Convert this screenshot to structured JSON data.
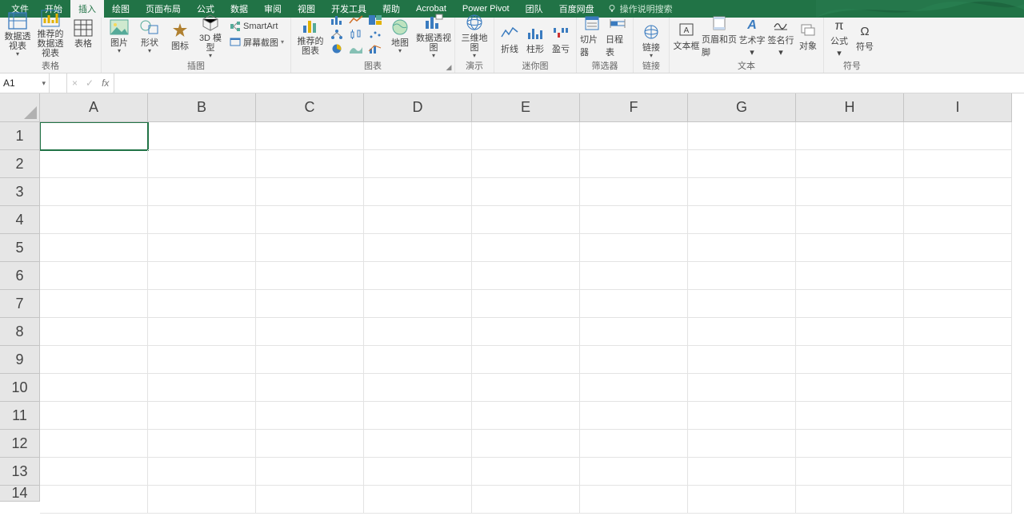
{
  "tabs": {
    "items": [
      "文件",
      "开始",
      "插入",
      "绘图",
      "页面布局",
      "公式",
      "数据",
      "审阅",
      "视图",
      "开发工具",
      "帮助",
      "Acrobat",
      "Power Pivot",
      "团队",
      "百度网盘"
    ],
    "active_index": 2
  },
  "tellme": {
    "placeholder": "操作说明搜索"
  },
  "ribbon": {
    "tables": {
      "pivot": "数据透视表",
      "recommended_pivot": "推荐的数据透视表",
      "table": "表格",
      "group": "表格"
    },
    "illustrations": {
      "pictures": "图片",
      "shapes": "形状",
      "icons": "图标",
      "models3d": "3D 模型",
      "smartart": "SmartArt",
      "screenshot": "屏幕截图",
      "group": "插图"
    },
    "charts": {
      "recommended": "推荐的图表",
      "maps": "地图",
      "pivotchart": "数据透视图",
      "group": "图表"
    },
    "tours": {
      "map3d": "三维地图",
      "group": "演示"
    },
    "sparklines": {
      "line": "折线",
      "column": "柱形",
      "winloss": "盈亏",
      "group": "迷你图"
    },
    "filters": {
      "slicer": "切片器",
      "timeline": "日程表",
      "group": "筛选器"
    },
    "links": {
      "link": "链接",
      "group": "链接"
    },
    "text": {
      "textbox": "文本框",
      "headerfooter": "页眉和页脚",
      "wordart": "艺术字",
      "sigline": "签名行",
      "object": "对象",
      "group": "文本"
    },
    "symbols": {
      "equation": "公式",
      "symbol": "符号",
      "group": "符号"
    }
  },
  "formula_bar": {
    "namebox": "A1",
    "fx_value": ""
  },
  "grid": {
    "columns": [
      "A",
      "B",
      "C",
      "D",
      "E",
      "F",
      "G",
      "H",
      "I"
    ],
    "rows": [
      "1",
      "2",
      "3",
      "4",
      "5",
      "6",
      "7",
      "8",
      "9",
      "10",
      "11",
      "12",
      "13",
      "14"
    ],
    "active_cell": "A1"
  },
  "colors": {
    "brand": "#217346"
  }
}
